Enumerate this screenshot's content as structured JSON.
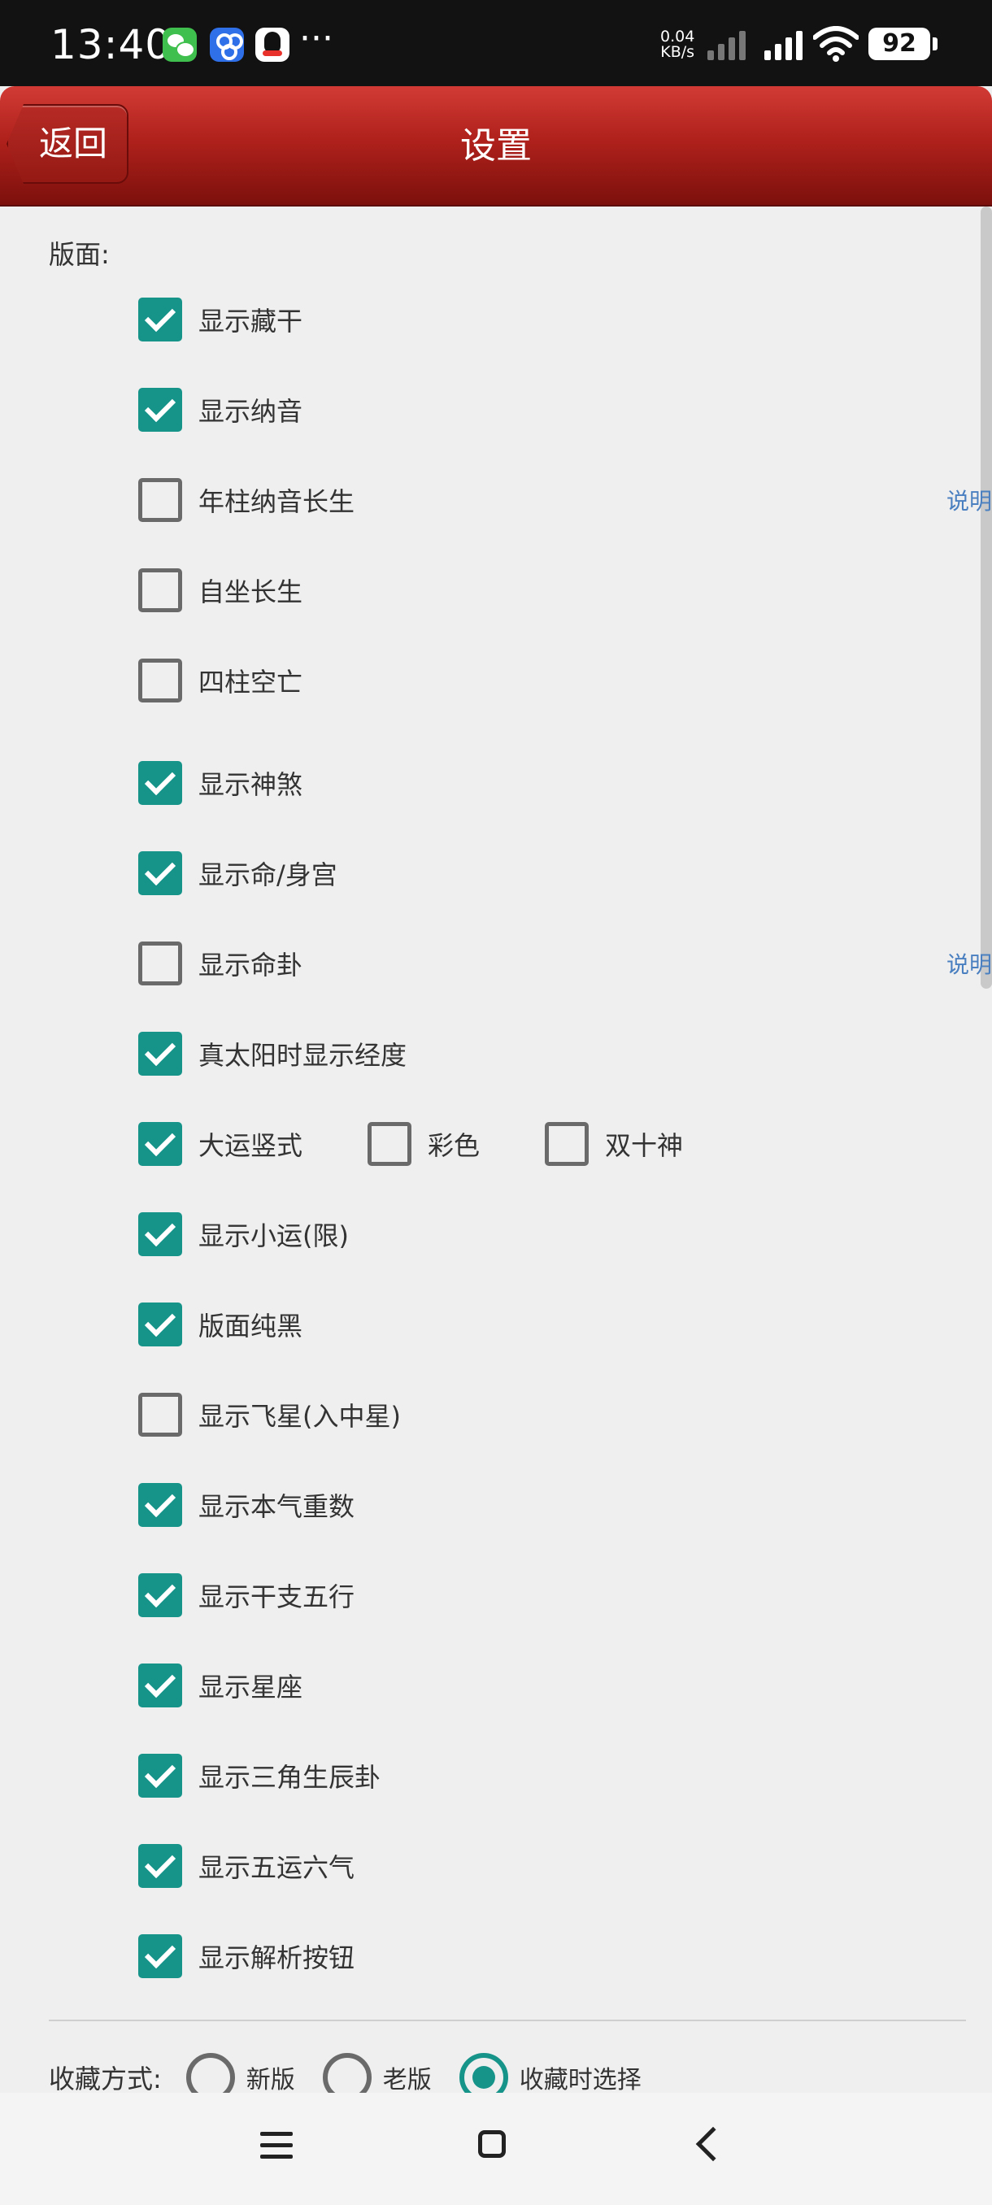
{
  "status_bar": {
    "time": "13:40",
    "more": "···",
    "net_speed_value": "0.04",
    "net_speed_unit": "KB/s",
    "battery": "92"
  },
  "header": {
    "back_label": "返回",
    "title": "设置"
  },
  "layout_section": {
    "label": "版面:",
    "items": [
      {
        "label": "显示藏干",
        "checked": true
      },
      {
        "label": "显示纳音",
        "checked": true
      },
      {
        "label": "年柱纳音长生",
        "checked": false,
        "link": "说明"
      },
      {
        "label": "自坐长生",
        "checked": false
      },
      {
        "label": "四柱空亡",
        "checked": false
      },
      {
        "label": "显示神煞",
        "checked": true
      },
      {
        "label": "显示命/身宫",
        "checked": true
      },
      {
        "label": "显示命卦",
        "checked": false,
        "link": "说明"
      },
      {
        "label": "真太阳时显示经度",
        "checked": true
      },
      {
        "label": "大运竖式",
        "checked": true
      },
      {
        "label": "彩色",
        "checked": false
      },
      {
        "label": "双十神",
        "checked": false
      },
      {
        "label": "显示小运(限)",
        "checked": true
      },
      {
        "label": "版面纯黑",
        "checked": true
      },
      {
        "label": "显示飞星(入中星)",
        "checked": false
      },
      {
        "label": "显示本气重数",
        "checked": true
      },
      {
        "label": "显示干支五行",
        "checked": true
      },
      {
        "label": "显示星座",
        "checked": true
      },
      {
        "label": "显示三角生辰卦",
        "checked": true
      },
      {
        "label": "显示五运六气",
        "checked": true
      },
      {
        "label": "显示解析按钮",
        "checked": true
      }
    ]
  },
  "favorite_section": {
    "label": "收藏方式:",
    "options": [
      {
        "label": "新版",
        "selected": false
      },
      {
        "label": "老版",
        "selected": false
      },
      {
        "label": "收藏时选择",
        "selected": true
      }
    ]
  },
  "colors": {
    "accent": "#17948a",
    "header_red": "#b0211c",
    "link_blue": "#4a7fc0"
  },
  "icons": [
    "wechat-icon",
    "baidu-netdisk-icon",
    "qq-icon",
    "signal-icon",
    "wifi-icon",
    "battery-icon",
    "nav-menu-icon",
    "nav-home-icon",
    "nav-back-icon"
  ]
}
